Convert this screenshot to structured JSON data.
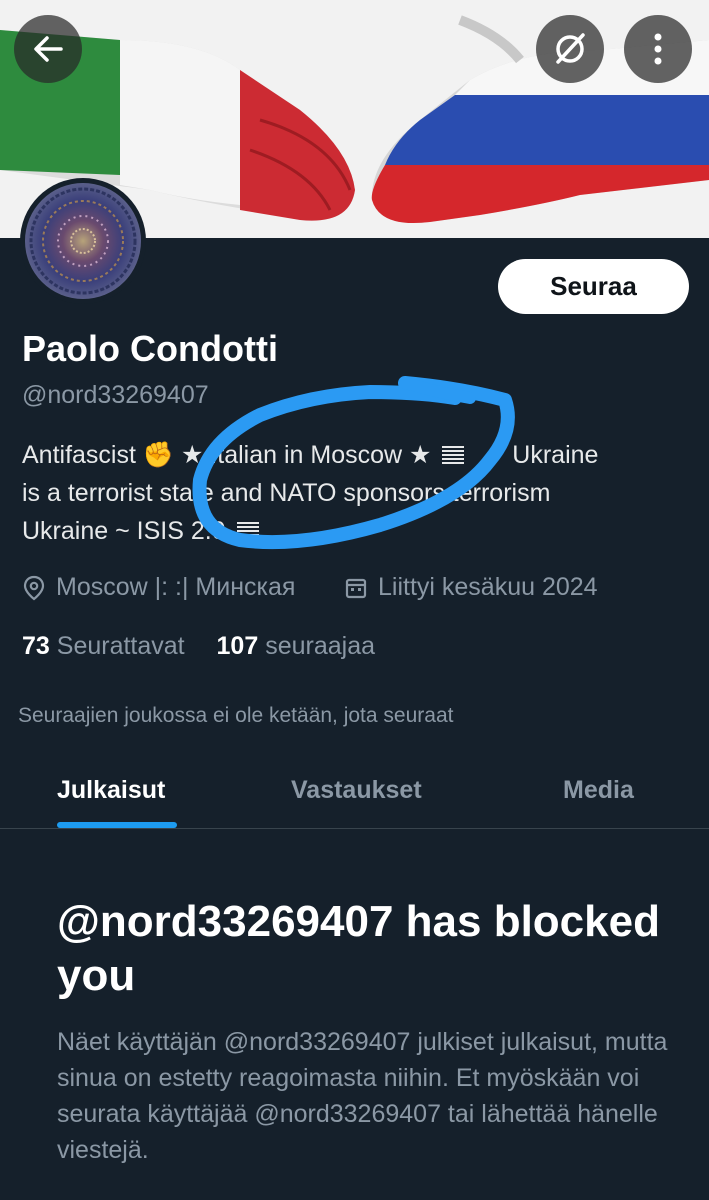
{
  "header": {
    "back_icon": "arrow-left-icon",
    "grok_icon": "circle-slash-icon",
    "more_icon": "more-vertical-icon"
  },
  "profile": {
    "display_name": "Paolo Condotti",
    "handle": "@nord33269407",
    "follow_label": "Seuraa",
    "bio": {
      "line1_a": "Antifascist ✊",
      "line1_b": "★ Italian in Moscow ★",
      "line1_c": "Ukraine",
      "line2": "is a terrorist state and NATO sponsors terrorism",
      "line3": "Ukraine ~ ISIS 2.0"
    },
    "location": "Moscow |: :| Минская",
    "joined": "Liittyi kesäkuu 2024",
    "following_count": "73",
    "following_label": "Seurattavat",
    "followers_count": "107",
    "followers_label": "seuraajaa",
    "mutual_note": "Seuraajien joukossa ei ole ketään, jota seuraat"
  },
  "tabs": [
    {
      "label": "Julkaisut",
      "active": true
    },
    {
      "label": "Vastaukset",
      "active": false
    },
    {
      "label": "Media",
      "active": false
    }
  ],
  "blocked": {
    "title": "@nord33269407 has blocked you",
    "body": "Näet käyttäjän @nord33269407 julkiset julkaisut, mutta sinua on estetty reagoimasta niihin. Et myöskään voi seurata käyttäjää @nord33269407 tai lähettää hänelle viestejä."
  },
  "colors": {
    "background": "#15202b",
    "accent": "#1d9bf0",
    "annotation": "#2b9af3"
  }
}
